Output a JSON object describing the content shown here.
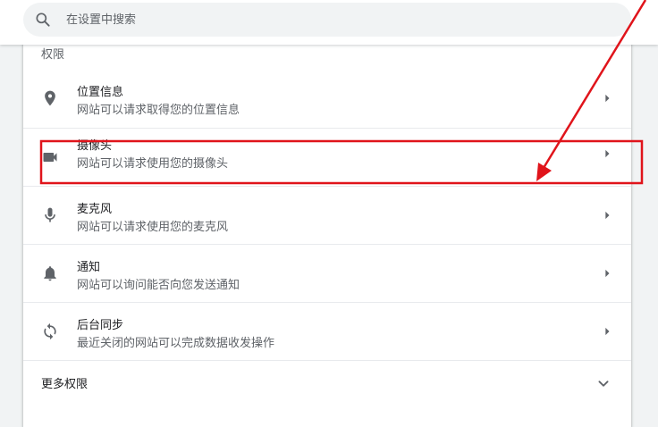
{
  "search": {
    "placeholder": "在设置中搜索"
  },
  "section": {
    "title": "权限"
  },
  "permissions": [
    {
      "title": "位置信息",
      "desc": "网站可以请求取得您的位置信息",
      "icon": "location-pin-icon"
    },
    {
      "title": "摄像头",
      "desc": "网站可以请求使用您的摄像头",
      "icon": "camera-icon"
    },
    {
      "title": "麦克风",
      "desc": "网站可以请求使用您的麦克风",
      "icon": "microphone-icon"
    },
    {
      "title": "通知",
      "desc": "网站可以询问能否向您发送通知",
      "icon": "bell-icon"
    },
    {
      "title": "后台同步",
      "desc": "最近关闭的网站可以完成数据收发操作",
      "icon": "sync-icon"
    }
  ],
  "more": {
    "label": "更多权限"
  },
  "colors": {
    "icon": "#5f6368",
    "annotation": "#e0141b",
    "card_background": "#ffffff",
    "page_background": "#f1f3f4"
  }
}
